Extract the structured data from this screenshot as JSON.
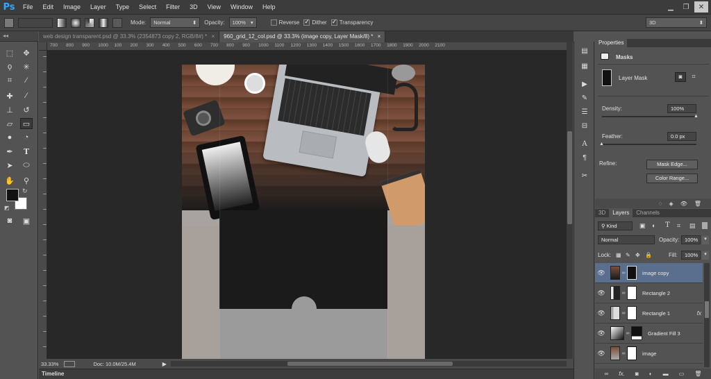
{
  "app": {
    "logo": "Ps"
  },
  "menu": [
    "File",
    "Edit",
    "Image",
    "Layer",
    "Type",
    "Select",
    "Filter",
    "3D",
    "View",
    "Window",
    "Help"
  ],
  "options": {
    "mode_label": "Mode:",
    "mode_value": "Normal",
    "opacity_label": "Opacity:",
    "opacity_value": "100%",
    "reverse_label": "Reverse",
    "dither_label": "Dither",
    "transparency_label": "Transparency",
    "workspace": "3D",
    "checks": {
      "reverse": false,
      "dither": true,
      "transparency": true
    }
  },
  "tabs": [
    {
      "label": "web design transparent.psd @ 33.3% (2354873 copy 2, RGB/8#) *",
      "close": "×"
    },
    {
      "label": "960_grid_12_col.psd @ 33.3% (image copy, Layer Mask/8) *",
      "close": "×"
    }
  ],
  "ruler": [
    "700",
    "800",
    "900",
    "1000",
    "100",
    "200",
    "300",
    "400",
    "500",
    "600",
    "700",
    "800",
    "900",
    "1000",
    "1100",
    "1200",
    "1300",
    "1400",
    "1500",
    "1600",
    "1700",
    "1800",
    "1900",
    "2000",
    "2100"
  ],
  "status": {
    "zoom": "33.33%",
    "doc": "Doc: 10.0M/25.4M"
  },
  "timeline": {
    "label": "Timeline"
  },
  "properties": {
    "tabs": [
      "Properties"
    ],
    "section": "Masks",
    "mask_label": "Layer Mask",
    "density_label": "Density:",
    "density_value": "100%",
    "feather_label": "Feather:",
    "feather_value": "0.0 px",
    "refine_label": "Refine:",
    "mask_edge_btn": "Mask Edge...",
    "color_range_btn": "Color Range...",
    "density_level": 1.0,
    "feather_level": 0.0
  },
  "layers": {
    "tabs": [
      "3D",
      "Layers",
      "Channels"
    ],
    "kind": "Kind",
    "blend": "Normal",
    "opacity_label": "Opacity:",
    "opacity_value": "100%",
    "lock_label": "Lock:",
    "fill_label": "Fill:",
    "fill_value": "100%",
    "items": [
      {
        "name": "image copy",
        "selected": true,
        "fx": ""
      },
      {
        "name": "Rectangle 2",
        "selected": false,
        "fx": ""
      },
      {
        "name": "Rectangle 1",
        "selected": false,
        "fx": "fx"
      },
      {
        "name": "Gradient Fill 3",
        "selected": false,
        "fx": ""
      },
      {
        "name": "image",
        "selected": false,
        "fx": ""
      }
    ]
  },
  "icons": {
    "eye": "eye-icon",
    "chain": "link-icon"
  }
}
